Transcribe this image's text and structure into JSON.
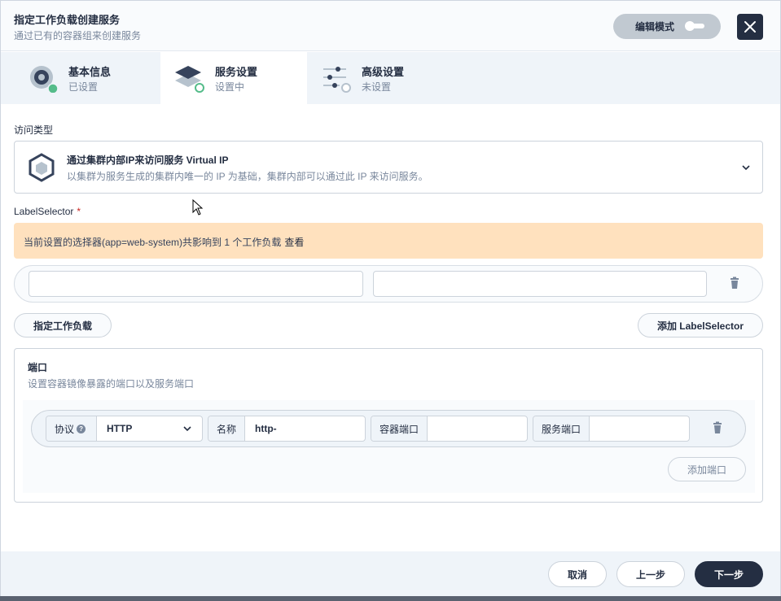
{
  "header": {
    "title": "指定工作负载创建服务",
    "subtitle": "通过已有的容器组来创建服务",
    "edit_mode_label": "编辑模式"
  },
  "steps": [
    {
      "label": "基本信息",
      "status": "已设置",
      "state": "done"
    },
    {
      "label": "服务设置",
      "status": "设置中",
      "state": "active"
    },
    {
      "label": "高级设置",
      "status": "未设置",
      "state": "pending"
    }
  ],
  "access_type": {
    "label": "访问类型",
    "title": "通过集群内部IP来访问服务 Virtual IP",
    "description": "以集群为服务生成的集群内唯一的 IP 为基础，集群内部可以通过此 IP 来访问服务。"
  },
  "label_selector": {
    "label": "LabelSelector",
    "required_mark": "*",
    "warning_text": "当前设置的选择器(app=web-system)共影响到 1 个工作负载",
    "warning_link": "查看",
    "key_value": "",
    "value_value": "",
    "specify_workload_label": "指定工作负载",
    "add_selector_label": "添加 LabelSelector"
  },
  "ports": {
    "title": "端口",
    "description": "设置容器镜像暴露的端口以及服务端口",
    "protocol_label": "协议",
    "protocol_help": "?",
    "protocol_value": "HTTP",
    "name_label": "名称",
    "name_value": "http-",
    "container_port_label": "容器端口",
    "container_port_value": "",
    "service_port_label": "服务端口",
    "service_port_value": "",
    "add_port_label": "添加端口"
  },
  "footer": {
    "cancel_label": "取消",
    "prev_label": "上一步",
    "next_label": "下一步"
  },
  "colors": {
    "primary_dark": "#242e42",
    "success": "#55bc8a",
    "warning_bg": "#ffe1be"
  }
}
